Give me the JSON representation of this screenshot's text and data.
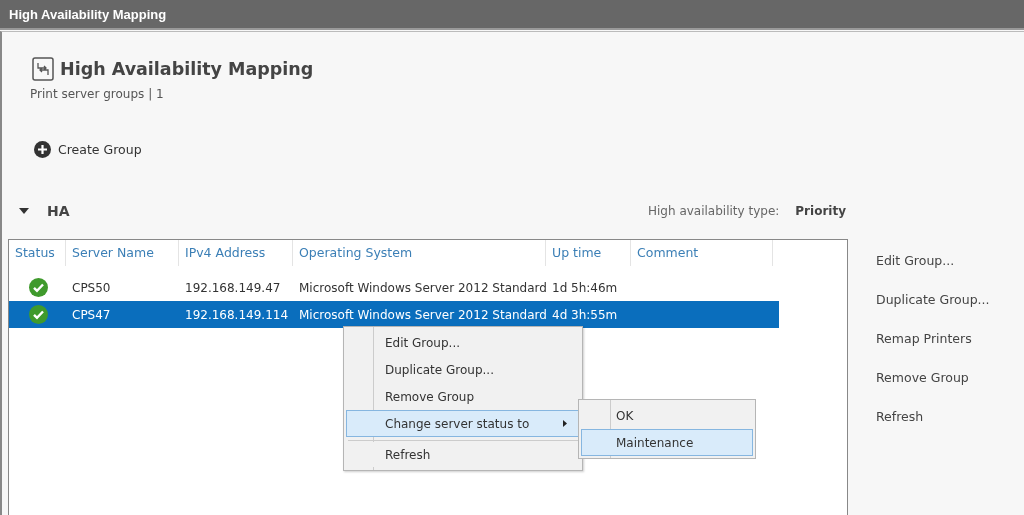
{
  "window": {
    "title": "High Availability Mapping"
  },
  "header": {
    "title": "High Availability Mapping",
    "subtitle": "Print server groups | 1"
  },
  "toolbar": [
    {
      "label": "Create Group"
    }
  ],
  "group": {
    "name": "HA",
    "expanded": true,
    "type_label": "High availability type:",
    "type_value": "Priority"
  },
  "table": {
    "columns": [
      "Status",
      "Server Name",
      "IPv4 Address",
      "Operating System",
      "Up time",
      "Comment"
    ],
    "rows": [
      {
        "ok": true,
        "server": "CPS50",
        "ip": "192.168.149.47",
        "os": "Microsoft Windows Server 2012 Standard",
        "uptime": "1d 5h:46m",
        "selected": false
      },
      {
        "ok": true,
        "server": "CPS47",
        "ip": "192.168.149.114",
        "os": "Microsoft Windows Server 2012 Standard",
        "uptime": "4d 3h:55m",
        "selected": true
      }
    ]
  },
  "context_menu": {
    "items": [
      {
        "label": "Edit Group...",
        "selected": false,
        "submenu": false,
        "separator_before": false
      },
      {
        "label": "Duplicate Group...",
        "selected": false,
        "submenu": false,
        "separator_before": false
      },
      {
        "label": "Remove Group",
        "selected": false,
        "submenu": false,
        "separator_before": false
      },
      {
        "label": "Change server status to",
        "selected": true,
        "submenu": true,
        "separator_before": false
      },
      {
        "label": "Refresh",
        "selected": false,
        "submenu": false,
        "separator_before": true
      }
    ],
    "submenu": [
      {
        "label": "OK",
        "selected": false
      },
      {
        "label": "Maintenance",
        "selected": true
      }
    ]
  },
  "actions": [
    "Edit Group...",
    "Duplicate Group...",
    "Remap Printers",
    "Remove Group",
    "Refresh"
  ]
}
